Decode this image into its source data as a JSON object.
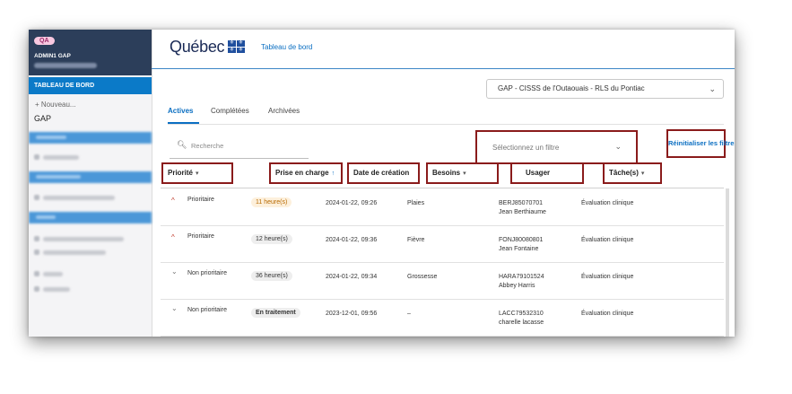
{
  "sidebar": {
    "badge": "QA",
    "user": "ADMIN1 GAP",
    "active_item": "TABLEAU DE BORD",
    "new_label": "+  Nouveau...",
    "new_sub": "GAP"
  },
  "header": {
    "logo_text": "Québec",
    "flag_symbol": "⚜",
    "nav_link": "Tableau de bord"
  },
  "org_select": {
    "value": "GAP - CISSS de l'Outaouais - RLS du Pontiac",
    "chevron": "chevron-down-icon"
  },
  "tabs": [
    {
      "label": "Actives",
      "active": true
    },
    {
      "label": "Complétées",
      "active": false
    },
    {
      "label": "Archivées",
      "active": false
    }
  ],
  "search": {
    "placeholder": "Recherche"
  },
  "filter": {
    "placeholder": "Sélectionnez un filtre",
    "reset_label": "Réinitialiser les filtres"
  },
  "columns": {
    "priorite": "Priorité",
    "prise": "Prise en charge",
    "date": "Date de création",
    "besoins": "Besoins",
    "usager": "Usager",
    "taches": "Tâche(s)"
  },
  "rows": [
    {
      "priority_level": "high",
      "priority": "Prioritaire",
      "prise": "11 heure(s)",
      "prise_style": "warn",
      "date": "2024-01-22, 09:26",
      "besoins": "Plaies",
      "usager_id": "BERJ85070701",
      "usager_name": "Jean Berthiaume",
      "tache": "Évaluation clinique"
    },
    {
      "priority_level": "high",
      "priority": "Prioritaire",
      "prise": "12 heure(s)",
      "prise_style": "neutral",
      "date": "2024-01-22, 09:36",
      "besoins": "Fièvre",
      "usager_id": "FONJ80080801",
      "usager_name": "Jean Fontaine",
      "tache": "Évaluation clinique"
    },
    {
      "priority_level": "low",
      "priority": "Non prioritaire",
      "prise": "36 heure(s)",
      "prise_style": "neutral",
      "date": "2024-01-22, 09:34",
      "besoins": "Grossesse",
      "usager_id": "HARA79101524",
      "usager_name": "Abbey Harris",
      "tache": "Évaluation clinique"
    },
    {
      "priority_level": "low",
      "priority": "Non prioritaire",
      "prise": "En traitement",
      "prise_style": "neutral",
      "date": "2023-12-01, 09:56",
      "besoins": "–",
      "usager_id": "LACC79532310",
      "usager_name": "charelle lacasse",
      "tache": "Évaluation clinique"
    }
  ],
  "colors": {
    "accent": "#0b6fc2",
    "highlight_box": "#8a1b1b",
    "priority_high": "#c0392b"
  }
}
